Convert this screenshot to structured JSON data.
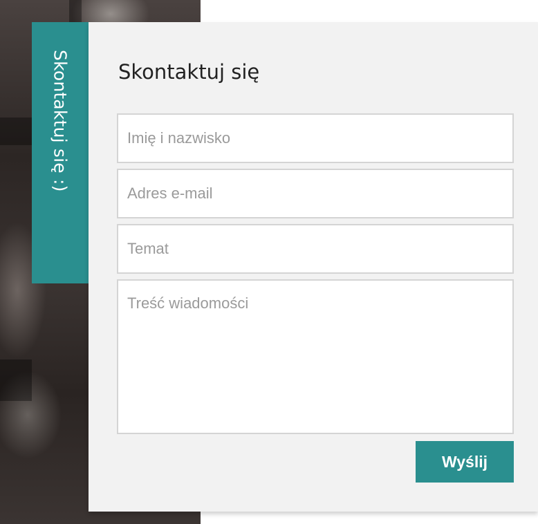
{
  "side_tab": {
    "label": "Skontaktuj się :)"
  },
  "contact_form": {
    "title": "Skontaktuj się",
    "name_placeholder": "Imię i nazwisko",
    "email_placeholder": "Adres e-mail",
    "subject_placeholder": "Temat",
    "message_placeholder": "Treść wiadomości",
    "submit_label": "Wyślij"
  },
  "colors": {
    "accent": "#2a8f8f",
    "panel_background": "#f2f2f2",
    "field_border": "#d4d4d4",
    "placeholder_text": "#9a9a9a"
  }
}
